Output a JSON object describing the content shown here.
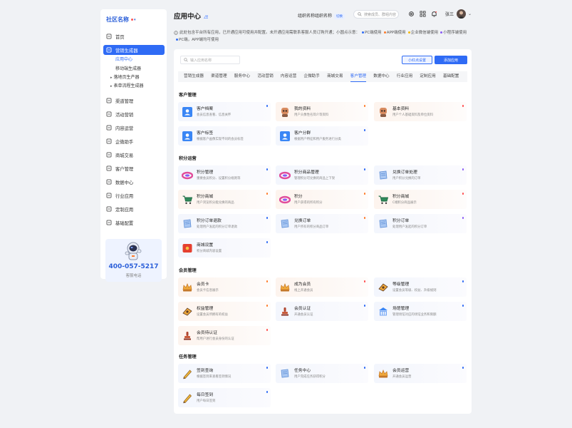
{
  "sidebar": {
    "brand": "社区名称",
    "items": [
      {
        "label": "首页",
        "icon": "home-icon"
      },
      {
        "label": "营销生成器",
        "icon": "marketing-icon",
        "active": true
      },
      {
        "label": "渠道管理",
        "icon": "channel-icon"
      },
      {
        "label": "活动营销",
        "icon": "activity-icon"
      },
      {
        "label": "内容运营",
        "icon": "content-icon"
      },
      {
        "label": "企微助手",
        "icon": "wecom-icon"
      },
      {
        "label": "商城交易",
        "icon": "mall-icon"
      },
      {
        "label": "客户管理",
        "icon": "customer-icon"
      },
      {
        "label": "数据中心",
        "icon": "data-icon"
      },
      {
        "label": "行业应用",
        "icon": "industry-icon"
      },
      {
        "label": "定制应用",
        "icon": "custom-icon"
      },
      {
        "label": "基础配置",
        "icon": "settings-icon"
      }
    ],
    "sub_items": [
      "应用中心",
      "移动端生成器",
      "落地页生产器",
      "表单流程生成器"
    ],
    "help_phone": "400-057-5217",
    "help_label": "客服电话"
  },
  "header": {
    "title": "应用中心",
    "org_name": "组织名称组织名称",
    "org_badge": "切换",
    "search_placeholder": "搜索成员、群组内容",
    "user_name": "张三"
  },
  "notice": {
    "text": "此处包含平台所有应用，已开通应用可使用并配置。未开通应用需联系客服人员订购开通；小圆点示意：",
    "legend": [
      {
        "label": "PC端使用",
        "color": "#2f6bf5"
      },
      {
        "label": "APP端使用",
        "color": "#ff7a29"
      },
      {
        "label": "企业微信端使用",
        "color": "#f5b800"
      },
      {
        "label": "小程序端使用",
        "color": "#8a5cf5"
      },
      {
        "label": "PC端，APP端均可使用",
        "color": "#2f6bf5"
      }
    ]
  },
  "toolbar": {
    "search_placeholder": "输入应用名称",
    "mini_settings": "小红点设置",
    "add_app": "添加应用"
  },
  "tabs": [
    "营销生成器",
    "渠道管理",
    "服务中心",
    "活动营销",
    "内容运营",
    "企微助手",
    "商城交易",
    "客户管理",
    "数据中心",
    "行业应用",
    "定制应用",
    "基础配置"
  ],
  "active_tab": "客户管理",
  "sections": [
    {
      "title": "客户管理",
      "cards": [
        {
          "title": "客户档案",
          "desc": "会员信息查看、信息关怀",
          "icon": "profile-card-icon",
          "tone": "blue",
          "dot": "#2f6bf5"
        },
        {
          "title": "我的资料",
          "desc": "用户头像性名简介等资料",
          "icon": "robot-avatar-icon",
          "tone": "warm",
          "dot": "#ff7a29"
        },
        {
          "title": "基本资料",
          "desc": "用户个人基础资料及单位资料",
          "icon": "robot-avatar-icon",
          "tone": "warm",
          "dot": "#ff4d4f"
        },
        {
          "title": "客户标签",
          "desc": "根据客户画像实现不同的会员标签",
          "icon": "profile-card-icon",
          "tone": "blue",
          "dot": ""
        },
        {
          "title": "客户分群",
          "desc": "根据用户特征和用户服务进行分类",
          "icon": "profile-card-icon",
          "tone": "blue",
          "dot": "#2f6bf5"
        }
      ]
    },
    {
      "title": "积分运营",
      "cards": [
        {
          "title": "积分管理",
          "desc": "重要会员积分、设置积分规则等",
          "icon": "points-ring-icon",
          "tone": "blue",
          "dot": "#2f6bf5"
        },
        {
          "title": "积分商品管理",
          "desc": "管理积分可兑换的商品上下架",
          "icon": "points-ring-icon",
          "tone": "blue",
          "dot": "#2f6bf5"
        },
        {
          "title": "兑换订单处理",
          "desc": "用户积分兑换的订单",
          "icon": "scroll-icon",
          "tone": "blue",
          "dot": "#8a5cf5"
        },
        {
          "title": "积分商城",
          "desc": "用户浏览积分能兑换的商品",
          "icon": "cart-icon",
          "tone": "warm",
          "dot": "#ff7a29"
        },
        {
          "title": "积分",
          "desc": "用户获得的所有积分",
          "icon": "points-ring-icon",
          "tone": "warm",
          "dot": "#ff7a29"
        },
        {
          "title": "积分商城",
          "desc": "C端积分商品展示",
          "icon": "cart-icon",
          "tone": "warm",
          "dot": "#ff4d4f"
        },
        {
          "title": "积分订单退款",
          "desc": "处理用户发起的积分订单退款",
          "icon": "scroll-icon",
          "tone": "blue",
          "dot": "#2f6bf5"
        },
        {
          "title": "兑换订单",
          "desc": "用户所有的积分商品订单",
          "icon": "scroll-icon",
          "tone": "blue",
          "dot": "#ff7a29"
        },
        {
          "title": "积分订单",
          "desc": "处理用户发起的积分订单",
          "icon": "scroll-icon",
          "tone": "blue",
          "dot": "#8a5cf5"
        },
        {
          "title": "商城设置",
          "desc": "积分商城内容设置",
          "icon": "red-box-icon",
          "tone": "blue",
          "dot": "#2f6bf5"
        }
      ]
    },
    {
      "title": "会员管理",
      "cards": [
        {
          "title": "会员卡",
          "desc": "会员卡信息展示",
          "icon": "crown-icon",
          "tone": "warm",
          "dot": "#ff7a29"
        },
        {
          "title": "成为会员",
          "desc": "线上开通会员",
          "icon": "crown-icon",
          "tone": "warm",
          "dot": "#ff4d4f"
        },
        {
          "title": "等级管理",
          "desc": "设置会员等级、权益、升级规则",
          "icon": "medal-icon",
          "tone": "blue",
          "dot": "#2f6bf5"
        },
        {
          "title": "权益管理",
          "desc": "设置会员所拥有的权益",
          "icon": "medal-icon",
          "tone": "warm",
          "dot": "#ff7a29"
        },
        {
          "title": "会员认证",
          "desc": "开通会员认证",
          "icon": "stamp-icon",
          "tone": "blue",
          "dot": "#2f6bf5"
        },
        {
          "title": "场馆管理",
          "desc": "管理场馆对应的场馆业务和限额",
          "icon": "building-icon",
          "tone": "blue",
          "dot": "#2f6bf5"
        },
        {
          "title": "会员待认证",
          "desc": "帮用户进行会员身份的认证",
          "icon": "stamp-icon",
          "tone": "warm",
          "dot": "#ff4d4f"
        }
      ]
    },
    {
      "title": "任务管理",
      "cards": [
        {
          "title": "签到查询",
          "desc": "根据签到来查看签到情况",
          "icon": "pencil-icon",
          "tone": "blue",
          "dot": "#2f6bf5"
        },
        {
          "title": "任务中心",
          "desc": "用户完成任务获得积分",
          "icon": "scroll-icon",
          "tone": "blue",
          "dot": "#2f6bf5"
        },
        {
          "title": "会员运营",
          "desc": "开通会员运营",
          "icon": "crown-icon",
          "tone": "blue",
          "dot": "#2f6bf5"
        },
        {
          "title": "每日签到",
          "desc": "用户每日签到",
          "icon": "pencil-icon",
          "tone": "blue",
          "dot": "#2f6bf5"
        }
      ]
    }
  ]
}
